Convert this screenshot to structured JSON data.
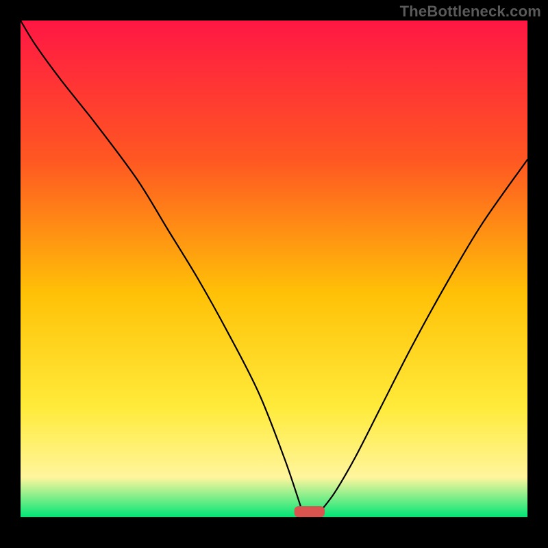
{
  "watermark": "TheBottleneck.com",
  "colors": {
    "frame": "#000000",
    "gradient_top": "#ff1744",
    "gradient_mid1": "#ff5722",
    "gradient_mid2": "#ffc107",
    "gradient_mid3": "#ffeb3b",
    "gradient_mid4": "#fff59d",
    "gradient_bottom": "#00e676",
    "curve": "#000000",
    "marker": "#d9534f"
  },
  "chart_data": {
    "type": "line",
    "title": "",
    "xlabel": "",
    "ylabel": "",
    "xlim": [
      0,
      100
    ],
    "ylim": [
      0,
      100
    ],
    "x": [
      0,
      3,
      8,
      15,
      23,
      29,
      35,
      41,
      47,
      52,
      55,
      56,
      57,
      58,
      59,
      62,
      66,
      71,
      77,
      84,
      91,
      100
    ],
    "values": [
      100,
      95,
      88,
      79,
      68,
      58,
      48,
      37,
      25,
      12,
      3,
      0,
      0,
      0,
      1,
      5,
      12,
      22,
      34,
      47,
      59,
      72
    ],
    "marker": {
      "x_center": 57,
      "y": 0,
      "width": 6,
      "height": 2.2
    },
    "annotations": []
  }
}
